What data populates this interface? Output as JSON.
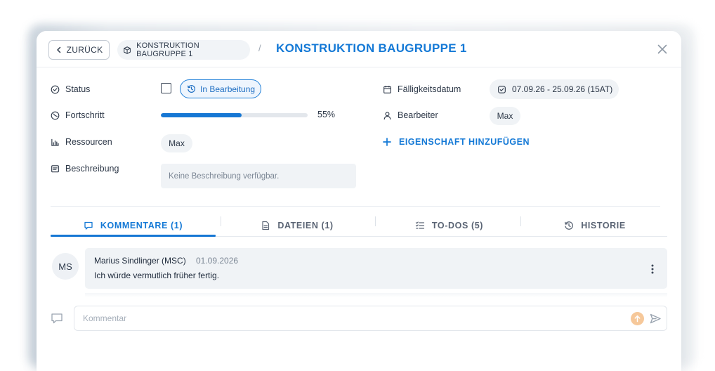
{
  "header": {
    "back_label": "ZURÜCK",
    "breadcrumb_label": "KONSTRUKTION BAUGRUPPE 1",
    "separator": "/",
    "title": "KONSTRUKTION BAUGRUPPE 1"
  },
  "properties": {
    "status": {
      "label": "Status",
      "value": "In Bearbeitung"
    },
    "progress": {
      "label": "Fortschritt",
      "value_text": "55%",
      "fraction": 0.55
    },
    "resources": {
      "label": "Ressourcen",
      "value": "Max"
    },
    "description": {
      "label": "Beschreibung",
      "value": "Keine Beschreibung verfügbar."
    },
    "due_date": {
      "label": "Fälligkeitsdatum",
      "value": "07.09.26 - 25.09.26 (15AT)"
    },
    "assignee": {
      "label": "Bearbeiter",
      "value": "Max"
    },
    "add_property_label": "EIGENSCHAFT HINZUFÜGEN"
  },
  "tabs": [
    {
      "label": "KOMMENTARE (1)",
      "icon": "comment-icon",
      "active": true
    },
    {
      "label": "DATEIEN (1)",
      "icon": "file-icon",
      "active": false
    },
    {
      "label": "TO-DOS (5)",
      "icon": "checklist-icon",
      "active": false
    },
    {
      "label": "HISTORIE",
      "icon": "history-icon",
      "active": false
    }
  ],
  "comments": [
    {
      "initials": "MS",
      "author": "Marius Sindlinger (MSC)",
      "date": "01.09.2026",
      "text": "Ich würde vermutlich früher fertig."
    }
  ],
  "comment_input": {
    "placeholder": "Kommentar"
  },
  "colors": {
    "accent": "#1677d4",
    "title": "#1479d6",
    "upload_button": "#f6c89a",
    "chip_background": "#f0f3f6"
  }
}
